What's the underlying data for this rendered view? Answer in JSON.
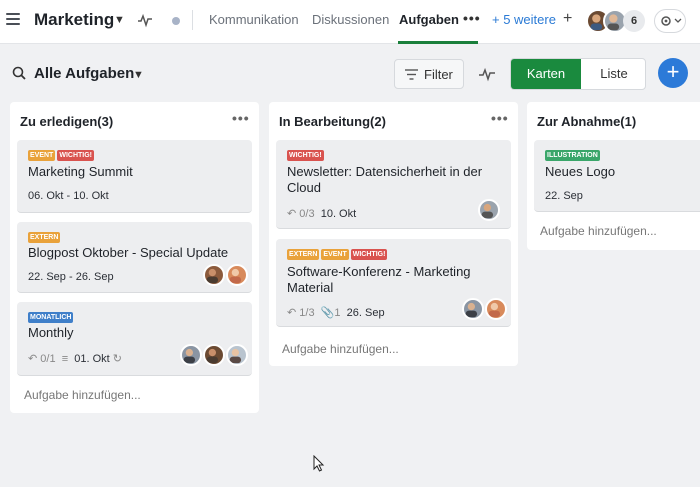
{
  "header": {
    "project_title": "Marketing",
    "tabs": [
      {
        "label": "Kommunikation"
      },
      {
        "label": "Diskussionen"
      },
      {
        "label": "Aufgaben"
      }
    ],
    "more_tabs_label": "+ 5 weitere",
    "add_tab_label": "+",
    "member_count": "6"
  },
  "toolbar": {
    "view_title": "Alle Aufgaben",
    "filter_label": "Filter",
    "view_cards_label": "Karten",
    "view_list_label": "Liste",
    "add_label": "+"
  },
  "columns": [
    {
      "title": "Zu erledigen(3)",
      "cards": [
        {
          "tags": [
            {
              "label": "EVENT",
              "color": "#e9a23b"
            },
            {
              "label": "WICHTIG!",
              "color": "#d9534f"
            }
          ],
          "title": "Marketing Summit",
          "date": "06. Okt - 10. Okt"
        },
        {
          "tags": [
            {
              "label": "EXTERN",
              "color": "#e9a23b"
            }
          ],
          "title": "Blogpost Oktober - Special Update",
          "date": "22. Sep - 26. Sep"
        },
        {
          "tags": [
            {
              "label": "MONATLICH",
              "color": "#3f7fc9"
            }
          ],
          "title": "Monthly",
          "subtasks": "0/1",
          "date": "01. Okt"
        }
      ],
      "add_task": "Aufgabe hinzufügen..."
    },
    {
      "title": "In Bearbeitung(2)",
      "cards": [
        {
          "tags": [
            {
              "label": "WICHTIG!",
              "color": "#d9534f"
            }
          ],
          "title": "Newsletter: Datensicherheit in der Cloud",
          "subtasks": "0/3",
          "date": "10. Okt"
        },
        {
          "tags": [
            {
              "label": "EXTERN",
              "color": "#e9a23b"
            },
            {
              "label": "EVENT",
              "color": "#e9a23b"
            },
            {
              "label": "WICHTIG!",
              "color": "#d9534f"
            }
          ],
          "title": "Software-Konferenz - Marketing Material",
          "subtasks": "1/3",
          "attachments": "1",
          "date": "26. Sep"
        }
      ],
      "add_task": "Aufgabe hinzufügen..."
    },
    {
      "title": "Zur Abnahme(1)",
      "cards": [
        {
          "tags": [
            {
              "label": "ILLUSTRATION",
              "color": "#3aa66a"
            }
          ],
          "title": "Neues Logo",
          "date": "22. Sep"
        }
      ],
      "add_task": "Aufgabe hinzufügen..."
    }
  ],
  "colors": {
    "accent_green": "#1a8a3e",
    "accent_blue": "#2c7ad8"
  }
}
